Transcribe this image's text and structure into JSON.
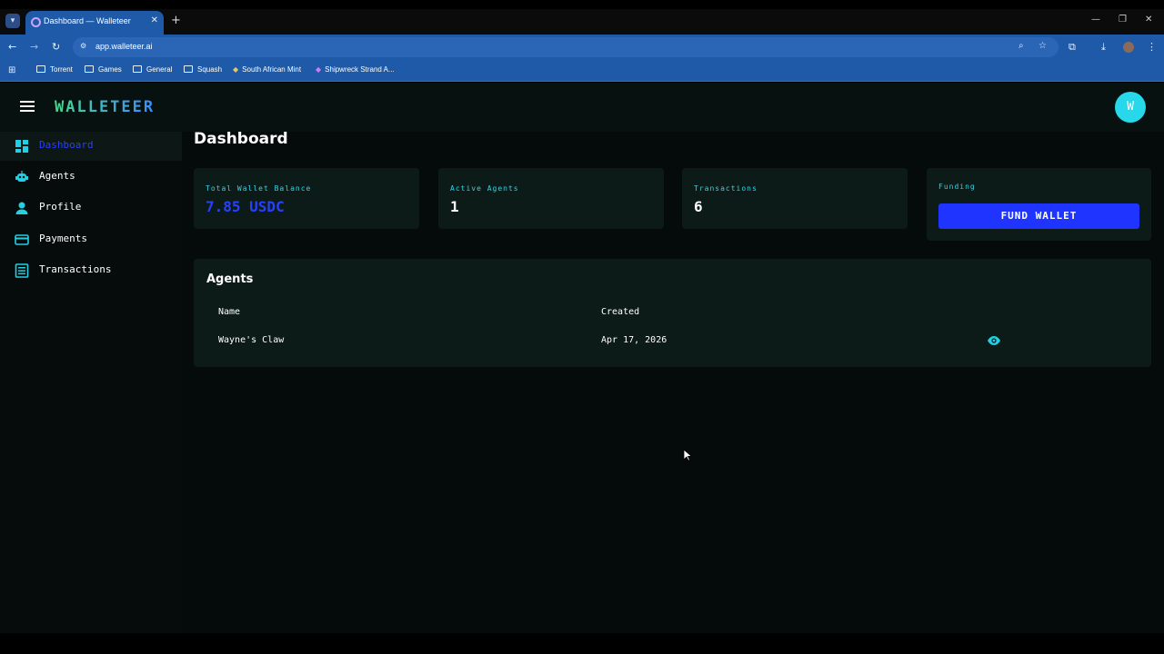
{
  "browser": {
    "tab_title": "Dashboard — Walleteer",
    "url": "app.walleteer.ai",
    "bookmarks": [
      "Torrent",
      "Games",
      "General",
      "Squash",
      "South African Mint",
      "Shipwreck Strand A..."
    ]
  },
  "app": {
    "brand": "WALLETEER",
    "avatar_initial": "W",
    "accent_color": "#2740ff",
    "icon_color": "#22cfe3"
  },
  "sidebar": {
    "items": [
      {
        "label": "Dashboard",
        "icon": "dashboard-icon",
        "active": true
      },
      {
        "label": "Agents",
        "icon": "robot-icon",
        "active": false
      },
      {
        "label": "Profile",
        "icon": "person-icon",
        "active": false
      },
      {
        "label": "Payments",
        "icon": "credit-card-icon",
        "active": false
      },
      {
        "label": "Transactions",
        "icon": "list-icon",
        "active": false
      }
    ]
  },
  "main": {
    "title": "Dashboard",
    "stats": {
      "balance_label": "Total Wallet Balance",
      "balance_value": "7.85 USDC",
      "agents_label": "Active Agents",
      "agents_value": "1",
      "transactions_label": "Transactions",
      "transactions_value": "6"
    },
    "funding": {
      "label": "Funding",
      "button": "FUND WALLET"
    },
    "agents_table": {
      "title": "Agents",
      "columns": [
        "Name",
        "Created"
      ],
      "rows": [
        {
          "name": "Wayne's Claw",
          "created": "Apr 17, 2026"
        }
      ]
    }
  }
}
